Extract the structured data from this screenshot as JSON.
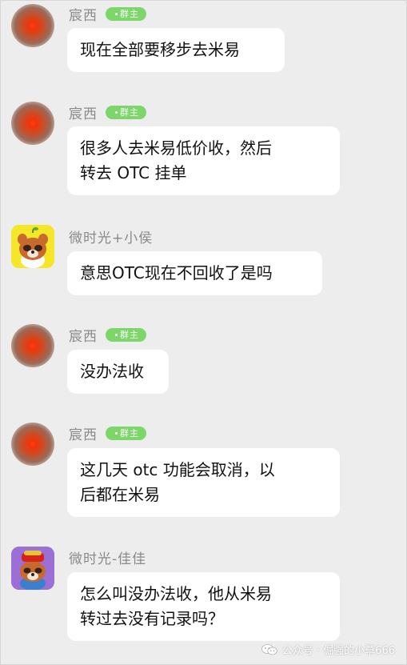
{
  "messages": [
    {
      "sender": "宸西",
      "badge": "群主",
      "text": "现在全部要移步去米易"
    },
    {
      "sender": "宸西",
      "badge": "群主",
      "text_line1": "很多人去米易低价收，然后",
      "text_line2": "转去 OTC 挂单"
    },
    {
      "sender": "微时光+小侯",
      "text": "意思OTC现在不回收了是吗"
    },
    {
      "sender": "宸西",
      "badge": "群主",
      "text": "没办法收"
    },
    {
      "sender": "宸西",
      "badge": "群主",
      "text_line1": "这几天 otc 功能会取消，以",
      "text_line2": "后都在米易"
    },
    {
      "sender": "微时光-佳佳",
      "text_line1": "怎么叫没办法收，他从米易",
      "text_line2": "转过去没有记录吗？"
    }
  ],
  "watermark": {
    "text": "公众号 · 倔强的小草666",
    "icon": "wechat-icon"
  },
  "colors": {
    "background": "#ededed",
    "bubble": "#ffffff",
    "badge": "#7cd66a",
    "sender": "#8a8a8a"
  }
}
